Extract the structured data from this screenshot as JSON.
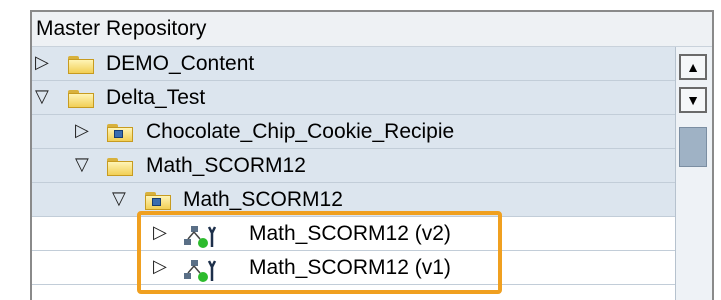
{
  "panel": {
    "title": "Master Repository"
  },
  "tree": {
    "items": [
      {
        "label": "DEMO_Content",
        "expander": "▷",
        "icon": "folder-icon"
      },
      {
        "label": "Delta_Test",
        "expander": "▽",
        "icon": "folder-icon"
      },
      {
        "label": "Chocolate_Chip_Cookie_Recipie",
        "expander": "▷",
        "icon": "content-folder-icon"
      },
      {
        "label": "Math_SCORM12",
        "expander": "▽",
        "icon": "folder-icon"
      },
      {
        "label": "Math_SCORM12",
        "expander": "▽",
        "icon": "content-folder-icon"
      },
      {
        "label": "Math_SCORM12 (v2)",
        "expander": "▷",
        "icon": "course-version-icon"
      },
      {
        "label": "Math_SCORM12 (v1)",
        "expander": "▷",
        "icon": "course-version-icon"
      }
    ]
  },
  "scrollbar": {
    "up": "▲",
    "down": "▼"
  },
  "highlight_color": "#f0a020"
}
